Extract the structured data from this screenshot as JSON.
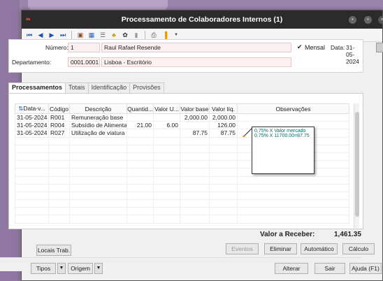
{
  "window": {
    "title": "Processamento de Colaboradores Internos (1)",
    "app_icon": "∞"
  },
  "toolbar": {
    "icons": [
      "first-icon",
      "prev-icon",
      "next-icon",
      "last-icon",
      "users-icon",
      "group-icon",
      "list-icon",
      "hierarchy-icon",
      "gear-icon",
      "lock-icon",
      "print-icon",
      "bookmark-icon"
    ]
  },
  "header": {
    "numero_label": "Número:",
    "numero_value": "1",
    "nome_value": "Raul Rafael Resende",
    "mensal_label": "Mensal",
    "data_label": "Data:",
    "data_value": "31-05-2024",
    "departamento_label": "Departamento:",
    "departamento_code": "0001.0001",
    "departamento_name": "Lisboa - Escritório"
  },
  "tabs": [
    "Processamentos",
    "Totais",
    "Identificação",
    "Provisões"
  ],
  "grid": {
    "columns": [
      "Data-v...",
      "Código",
      "Descrição",
      "Quantid...",
      "Valor U...",
      "Valor base",
      "Valor líq.",
      "Observações"
    ],
    "rows": [
      [
        "31-05-2024",
        "R001",
        "Remuneração base",
        "",
        "",
        "2,000.00",
        "2,000.00",
        ""
      ],
      [
        "31-05-2024",
        "R004",
        "Subsídio de Alimenta...",
        "21.00",
        "6.00",
        "",
        "126.00",
        ""
      ],
      [
        "31-05-2024",
        "R027",
        "Utilização de viatura ...",
        "",
        "",
        "87.75",
        "87.75",
        ""
      ]
    ]
  },
  "note": {
    "line1": "0,75% X Valor mercado",
    "line2": "0,75% X 11700.00=87.75"
  },
  "total": {
    "label": "Valor a Receber:",
    "value": "1,461.35"
  },
  "buttons": {
    "locais": "Locais Trab.",
    "eventos": "Eventos",
    "eliminar": "Eliminar",
    "automatico": "Automático",
    "calculo": "Cálculo",
    "tipos": "Tipos",
    "origem": "Origem",
    "alterar": "Alterar",
    "sair": "Sair",
    "ajuda": "Ajuda (F1)"
  },
  "colors": {
    "titlebar": "#2b2b2b",
    "field_bg": "#fdf0f0",
    "note_text": "#0a6a6a"
  }
}
